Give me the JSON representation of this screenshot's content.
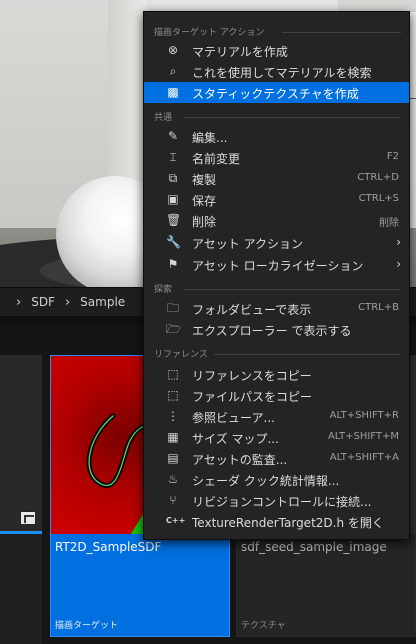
{
  "breadcrumb": {
    "items": [
      "SDF",
      "Sample"
    ],
    "separator": "›"
  },
  "assets": [
    {
      "name": "RT2D_SampleSDF",
      "type": "描画ターゲット",
      "selected": true,
      "accent": "#0070e0"
    },
    {
      "name": "sdf_seed_sample_image",
      "type": "テクスチャ",
      "selected": false
    }
  ],
  "context_menu": {
    "sections": [
      {
        "title": "描画ターゲット アクション",
        "items": [
          {
            "label": "マテリアルを作成",
            "icon": "material-icon",
            "shortcut": ""
          },
          {
            "label": "これを使用してマテリアルを検索",
            "icon": "search-icon",
            "shortcut": ""
          },
          {
            "label": "スタティックテクスチャを作成",
            "icon": "checker-icon",
            "shortcut": "",
            "highlighted": true
          }
        ]
      },
      {
        "title": "共通",
        "items": [
          {
            "label": "編集...",
            "icon": "edit-icon",
            "shortcut": ""
          },
          {
            "label": "名前変更",
            "icon": "rename-icon",
            "shortcut": "F2"
          },
          {
            "label": "複製",
            "icon": "duplicate-icon",
            "shortcut": "CTRL+D"
          },
          {
            "label": "保存",
            "icon": "save-icon",
            "shortcut": "CTRL+S"
          },
          {
            "label": "削除",
            "icon": "trash-icon",
            "shortcut": "削除"
          },
          {
            "label": "アセット アクション",
            "icon": "wrench-icon",
            "shortcut": "",
            "submenu": true
          },
          {
            "label": "アセット ローカライゼーション",
            "icon": "flag-icon",
            "shortcut": "",
            "submenu": true
          }
        ]
      },
      {
        "title": "探索",
        "items": [
          {
            "label": "フォルダビューで表示",
            "icon": "folder-search-icon",
            "shortcut": "CTRL+B"
          },
          {
            "label": "エクスプローラー で表示する",
            "icon": "folder-icon",
            "shortcut": ""
          }
        ]
      },
      {
        "title": "リファレンス",
        "items": [
          {
            "label": "リファレンスをコピー",
            "icon": "copy-icon",
            "shortcut": ""
          },
          {
            "label": "ファイルパスをコピー",
            "icon": "copy-path-icon",
            "shortcut": ""
          },
          {
            "label": "参照ビューア...",
            "icon": "reference-viewer-icon",
            "shortcut": "ALT+SHIFT+R"
          },
          {
            "label": "サイズ マップ...",
            "icon": "size-map-icon",
            "shortcut": "ALT+SHIFT+M"
          },
          {
            "label": "アセットの監査...",
            "icon": "audit-icon",
            "shortcut": "ALT+SHIFT+A"
          },
          {
            "label": "シェーダ クック統計情報...",
            "icon": "shader-icon",
            "shortcut": ""
          },
          {
            "label": "リビジョンコントロールに接続...",
            "icon": "branch-icon",
            "shortcut": ""
          },
          {
            "label": "TextureRenderTarget2D.h を開く",
            "icon": "cpp-icon",
            "shortcut": ""
          }
        ]
      }
    ]
  }
}
